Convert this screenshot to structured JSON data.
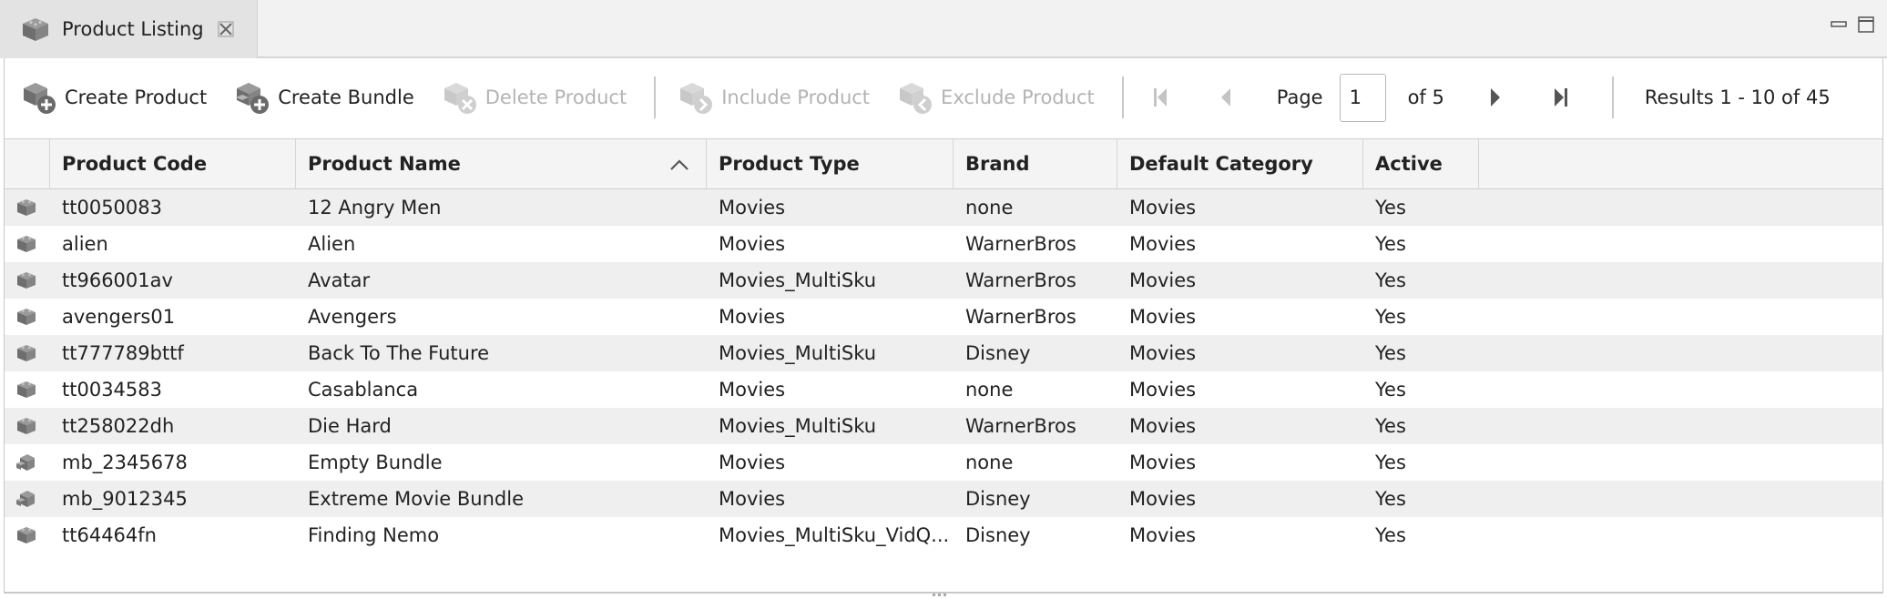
{
  "tab": {
    "title": "Product Listing",
    "tab_icon": "product-cube-icon",
    "close_icon": "close-icon"
  },
  "window_controls": {
    "minimize_icon": "minimize-icon",
    "maximize_icon": "maximize-icon"
  },
  "toolbar": {
    "create_product": "Create Product",
    "create_bundle": "Create Bundle",
    "delete_product": "Delete Product",
    "include_product": "Include Product",
    "exclude_product": "Exclude Product"
  },
  "pager": {
    "page_label": "Page",
    "current_page": "1",
    "of_label": "of 5",
    "results": "Results 1 - 10 of 45"
  },
  "table": {
    "columns": [
      "Product Code",
      "Product Name",
      "Product Type",
      "Brand",
      "Default Category",
      "Active"
    ],
    "sorted_column": "Product Name",
    "sort_direction": "ascending",
    "rows": [
      {
        "code": "tt0050083",
        "name": "12 Angry Men",
        "type": "Movies",
        "brand": "none",
        "category": "Movies",
        "active": "Yes",
        "icon": "product-icon"
      },
      {
        "code": "alien",
        "name": "Alien",
        "type": "Movies",
        "brand": "WarnerBros",
        "category": "Movies",
        "active": "Yes",
        "icon": "product-icon"
      },
      {
        "code": "tt966001av",
        "name": "Avatar",
        "type": "Movies_MultiSku",
        "brand": "WarnerBros",
        "category": "Movies",
        "active": "Yes",
        "icon": "product-icon"
      },
      {
        "code": "avengers01",
        "name": "Avengers",
        "type": "Movies",
        "brand": "WarnerBros",
        "category": "Movies",
        "active": "Yes",
        "icon": "product-icon"
      },
      {
        "code": "tt777789bttf",
        "name": "Back To The Future",
        "type": "Movies_MultiSku",
        "brand": "Disney",
        "category": "Movies",
        "active": "Yes",
        "icon": "product-icon"
      },
      {
        "code": "tt0034583",
        "name": "Casablanca",
        "type": "Movies",
        "brand": "none",
        "category": "Movies",
        "active": "Yes",
        "icon": "product-icon"
      },
      {
        "code": "tt258022dh",
        "name": "Die Hard",
        "type": "Movies_MultiSku",
        "brand": "WarnerBros",
        "category": "Movies",
        "active": "Yes",
        "icon": "product-icon"
      },
      {
        "code": "mb_2345678",
        "name": "Empty Bundle",
        "type": "Movies",
        "brand": "none",
        "category": "Movies",
        "active": "Yes",
        "icon": "bundle-icon"
      },
      {
        "code": "mb_9012345",
        "name": "Extreme Movie Bundle",
        "type": "Movies",
        "brand": "Disney",
        "category": "Movies",
        "active": "Yes",
        "icon": "bundle-icon"
      },
      {
        "code": "tt64464fn",
        "name": "Finding Nemo",
        "type": "Movies_MultiSku_VidQ...",
        "brand": "Disney",
        "category": "Movies",
        "active": "Yes",
        "icon": "product-icon"
      }
    ]
  },
  "colors": {
    "row_alt": "#efefef",
    "header_bg": "#f4f4f4",
    "disabled_text": "#b3b3b3",
    "icon_gray": "#8a8a8a"
  }
}
